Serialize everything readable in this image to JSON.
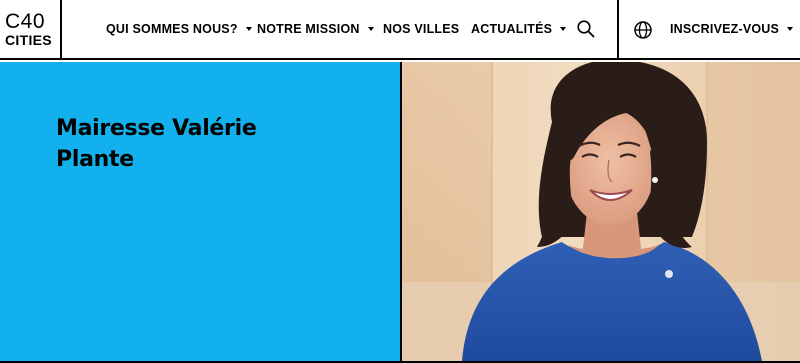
{
  "logo": {
    "line1": "C40",
    "line2": "CITIES"
  },
  "nav": {
    "items": [
      {
        "label": "QUI SOMMES NOUS?",
        "has_dropdown": true
      },
      {
        "label": "NOTRE MISSION",
        "has_dropdown": true
      },
      {
        "label": "NOS VILLES",
        "has_dropdown": false
      },
      {
        "label": "ACTUALITÉS",
        "has_dropdown": true
      }
    ],
    "search_icon": "search-icon",
    "language_icon": "globe-icon",
    "signup": {
      "label": "INSCRIVEZ-VOUS",
      "has_dropdown": true
    }
  },
  "hero": {
    "title_line1": "Mairesse Valérie",
    "title_line2": "Plante",
    "background_color": "#12b0ec",
    "photo": "portrait"
  }
}
